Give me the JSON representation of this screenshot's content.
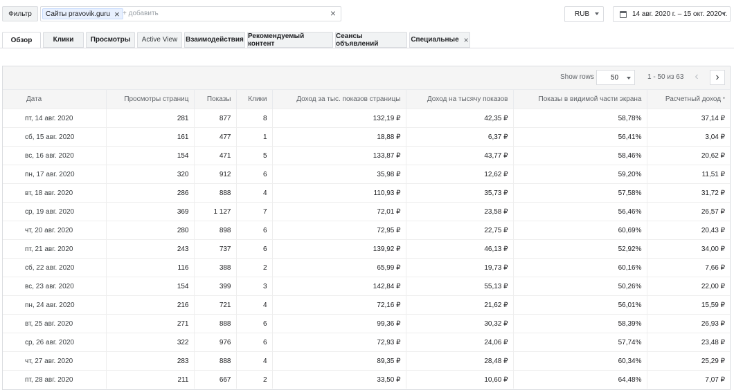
{
  "filter": {
    "button_label": "Фильтр",
    "chip_label": "Сайты pravovik.guru",
    "add_placeholder": "+ добавить"
  },
  "currency": {
    "selected": "RUB"
  },
  "date_range": {
    "label": "14 авг. 2020 г. – 15 окт. 2020 г."
  },
  "tabs": [
    {
      "label": "Обзор"
    },
    {
      "label": "Клики"
    },
    {
      "label": "Просмотры"
    },
    {
      "label": "Active View"
    },
    {
      "label": "Взаимодействия"
    },
    {
      "label": "Рекомендуемый контент"
    },
    {
      "label": "Сеансы объявлений"
    },
    {
      "label": "Специальные"
    }
  ],
  "pager": {
    "show_rows_label": "Show rows",
    "rows_value": "50",
    "range_text": "1 - 50 из 63"
  },
  "table": {
    "columns": [
      "Дата",
      "Просмотры страниц",
      "Показы",
      "Клики",
      "Доход за тыс. показов страницы",
      "Доход на тысячу показов",
      "Показы в видимой части экрана",
      "Расчетный доход"
    ],
    "rows": [
      [
        "пт, 14 авг. 2020",
        "281",
        "877",
        "8",
        "132,19 ₽",
        "42,35 ₽",
        "58,78%",
        "37,14 ₽"
      ],
      [
        "сб, 15 авг. 2020",
        "161",
        "477",
        "1",
        "18,88 ₽",
        "6,37 ₽",
        "56,41%",
        "3,04 ₽"
      ],
      [
        "вс, 16 авг. 2020",
        "154",
        "471",
        "5",
        "133,87 ₽",
        "43,77 ₽",
        "58,46%",
        "20,62 ₽"
      ],
      [
        "пн, 17 авг. 2020",
        "320",
        "912",
        "6",
        "35,98 ₽",
        "12,62 ₽",
        "59,20%",
        "11,51 ₽"
      ],
      [
        "вт, 18 авг. 2020",
        "286",
        "888",
        "4",
        "110,93 ₽",
        "35,73 ₽",
        "57,58%",
        "31,72 ₽"
      ],
      [
        "ср, 19 авг. 2020",
        "369",
        "1 127",
        "7",
        "72,01 ₽",
        "23,58 ₽",
        "56,46%",
        "26,57 ₽"
      ],
      [
        "чт, 20 авг. 2020",
        "280",
        "898",
        "6",
        "72,95 ₽",
        "22,75 ₽",
        "60,69%",
        "20,43 ₽"
      ],
      [
        "пт, 21 авг. 2020",
        "243",
        "737",
        "6",
        "139,92 ₽",
        "46,13 ₽",
        "52,92%",
        "34,00 ₽"
      ],
      [
        "сб, 22 авг. 2020",
        "116",
        "388",
        "2",
        "65,99 ₽",
        "19,73 ₽",
        "60,16%",
        "7,66 ₽"
      ],
      [
        "вс, 23 авг. 2020",
        "154",
        "399",
        "3",
        "142,84 ₽",
        "55,13 ₽",
        "50,26%",
        "22,00 ₽"
      ],
      [
        "пн, 24 авг. 2020",
        "216",
        "721",
        "4",
        "72,16 ₽",
        "21,62 ₽",
        "56,01%",
        "15,59 ₽"
      ],
      [
        "вт, 25 авг. 2020",
        "271",
        "888",
        "6",
        "99,36 ₽",
        "30,32 ₽",
        "58,39%",
        "26,93 ₽"
      ],
      [
        "ср, 26 авг. 2020",
        "322",
        "976",
        "6",
        "72,93 ₽",
        "24,06 ₽",
        "57,74%",
        "23,48 ₽"
      ],
      [
        "чт, 27 авг. 2020",
        "283",
        "888",
        "4",
        "89,35 ₽",
        "28,48 ₽",
        "60,34%",
        "25,29 ₽"
      ],
      [
        "пт, 28 авг. 2020",
        "211",
        "667",
        "2",
        "33,50 ₽",
        "10,60 ₽",
        "64,48%",
        "7,07 ₽"
      ]
    ]
  }
}
